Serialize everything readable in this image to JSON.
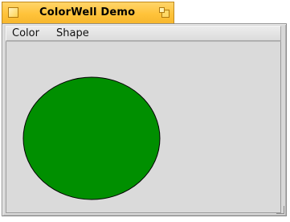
{
  "window": {
    "title": "ColorWell Demo"
  },
  "menu": {
    "items": [
      {
        "label": "Color"
      },
      {
        "label": "Shape"
      }
    ]
  },
  "canvas": {
    "shape": "ellipse",
    "fill_color": "#008f00",
    "stroke_color": "#000000",
    "title_tab_color": "#ffc33a"
  },
  "icons": {
    "close": "close-box-icon",
    "zoom": "zoom-box-icon",
    "resize": "resize-corner-icon"
  }
}
